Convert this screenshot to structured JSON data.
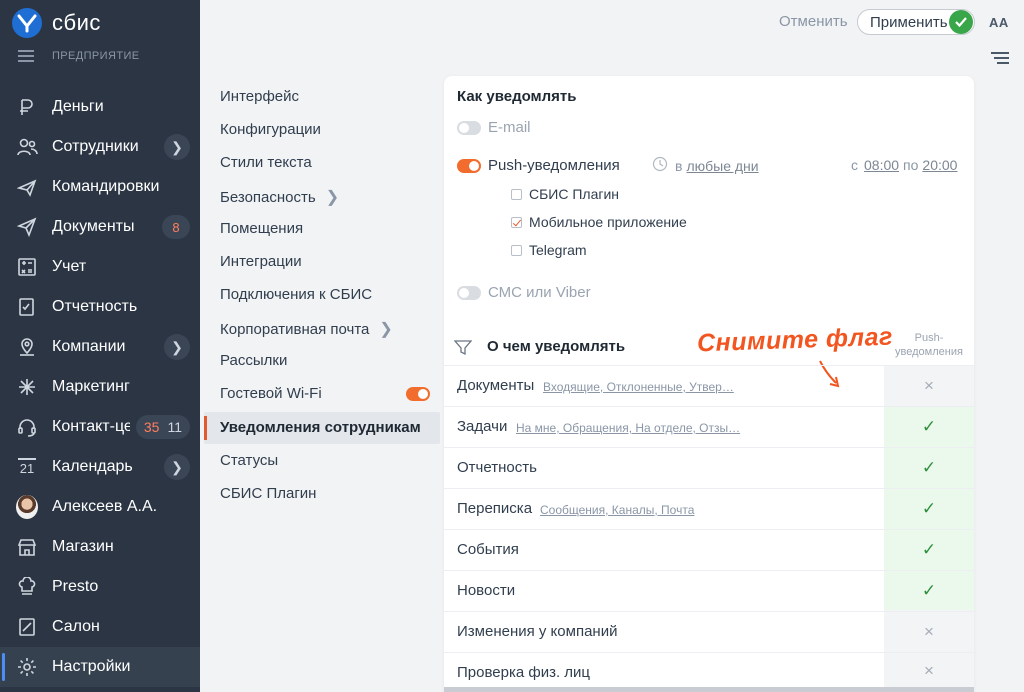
{
  "app": {
    "logo_text": "сбис",
    "org_label": "ПРЕДПРИЯТИЕ"
  },
  "nav": [
    {
      "label": "Деньги",
      "icon": "money-icon"
    },
    {
      "label": "Сотрудники",
      "icon": "employees-icon",
      "chevron": "❯"
    },
    {
      "label": "Командировки",
      "icon": "plane-icon"
    },
    {
      "label": "Документы",
      "icon": "paper-plane-icon",
      "badge": "8"
    },
    {
      "label": "Учет",
      "icon": "calculator-icon"
    },
    {
      "label": "Отчетность",
      "icon": "report-icon"
    },
    {
      "label": "Компании",
      "icon": "companies-icon",
      "chevron": "❯"
    },
    {
      "label": "Маркетинг",
      "icon": "marketing-icon"
    },
    {
      "label": "Контакт-центр",
      "icon": "headset-icon",
      "badge1": "35",
      "badge2": "11"
    },
    {
      "label": "Календарь",
      "icon": "calendar-icon",
      "icon_text": "21",
      "chevron": "❯"
    },
    {
      "label": "Алексеев А.А.",
      "icon": "avatar"
    },
    {
      "label": "Магазин",
      "icon": "store-icon"
    },
    {
      "label": "Presto",
      "icon": "chef-icon"
    },
    {
      "label": "Салон",
      "icon": "salon-icon"
    },
    {
      "label": "Настройки",
      "icon": "gear-icon",
      "active": true
    }
  ],
  "settings_menu": [
    {
      "label": "Интерфейс"
    },
    {
      "label": "Конфигурации"
    },
    {
      "label": "Стили текста"
    },
    {
      "label": "Безопасность",
      "arrow": "❯"
    },
    {
      "label": "Помещения"
    },
    {
      "label": "Интеграции"
    },
    {
      "label": "Подключения к СБИС"
    },
    {
      "label": "Корпоративная почта",
      "arrow": "❯"
    },
    {
      "label": "Рассылки"
    },
    {
      "label": "Гостевой Wi-Fi",
      "toggle": "on"
    },
    {
      "label": "Уведомления сотрудникам",
      "active": true
    },
    {
      "label": "Статусы"
    },
    {
      "label": "СБИС Плагин"
    }
  ],
  "toolbar": {
    "cancel": "Отменить",
    "apply": "Применить",
    "font_size": "АА"
  },
  "how": {
    "title": "Как уведомлять",
    "email": "E-mail",
    "push": "Push-уведомления",
    "days_prefix": "в",
    "days_link": "любые дни",
    "time_from_label": "с",
    "time_from": "08:00",
    "time_to_label": "по",
    "time_to": "20:00",
    "channels": [
      {
        "label": "СБИС Плагин",
        "checked": false
      },
      {
        "label": "Мобильное приложение",
        "checked": true
      },
      {
        "label": "Telegram",
        "checked": false
      }
    ],
    "sms": "СМС или Viber"
  },
  "what": {
    "title": "О чем уведомлять",
    "column_header_1": "Push-",
    "column_header_2": "уведомления",
    "annotation": "Снимите флаг",
    "rows": [
      {
        "name": "Документы",
        "sub": "Входящие, Отклоненные, Утвер…",
        "push": "×"
      },
      {
        "name": "Задачи",
        "sub": "На мне, Обращения, На отделе, Отзы…",
        "push": "✓"
      },
      {
        "name": "Отчетность",
        "sub": "",
        "push": "✓"
      },
      {
        "name": "Переписка",
        "sub": "Сообщения, Каналы, Почта",
        "push": "✓"
      },
      {
        "name": "События",
        "sub": "",
        "push": "✓"
      },
      {
        "name": "Новости",
        "sub": "",
        "push": "✓"
      },
      {
        "name": "Изменения у компаний",
        "sub": "",
        "push": "×"
      },
      {
        "name": "Проверка физ. лиц",
        "sub": "",
        "push": "×"
      }
    ]
  },
  "colors": {
    "sidebar_bg": "#2b3543",
    "accent_orange": "#f26d2d",
    "check_green": "#2e8f3c",
    "apply_ok": "#3aa64a"
  }
}
